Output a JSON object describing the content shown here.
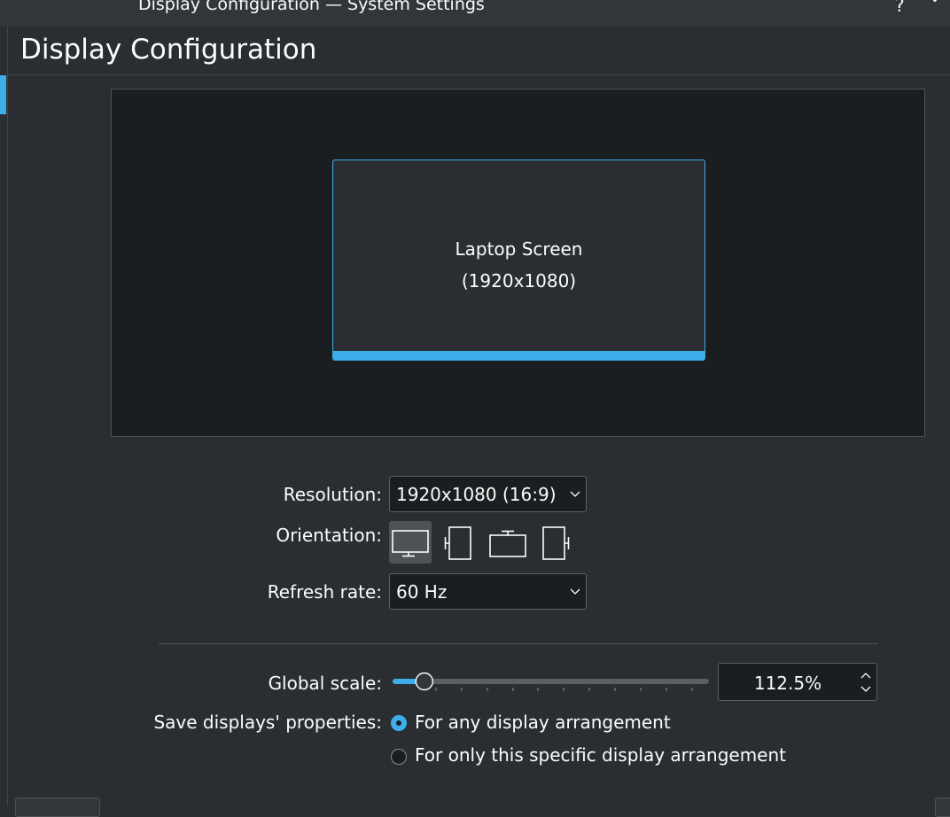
{
  "window": {
    "title": "Display Configuration — System Settings",
    "help_glyph": "?"
  },
  "page": {
    "title": "Display Configuration"
  },
  "arrangement": {
    "screen_name": "Laptop Screen",
    "screen_resolution": "(1920x1080)"
  },
  "settings": {
    "resolution_label": "Resolution:",
    "resolution_value": "1920x1080 (16:9)",
    "orientation_label": "Orientation:",
    "orientation_options": [
      "landscape",
      "portrait-left",
      "landscape-flipped",
      "portrait-right"
    ],
    "orientation_selected": "landscape",
    "refresh_label": "Refresh rate:",
    "refresh_value": "60 Hz",
    "scale_label": "Global scale:",
    "scale_value": "112.5%",
    "scale_fraction": 0.07,
    "save_label": "Save displays' properties:",
    "save_option_1": "For any display arrangement",
    "save_option_2": "For only this specific display arrangement",
    "save_selected": 1
  },
  "colors": {
    "accent": "#3daee9",
    "background": "#2a2e32",
    "field": "#1b1e20",
    "text": "#fcfcfc"
  }
}
